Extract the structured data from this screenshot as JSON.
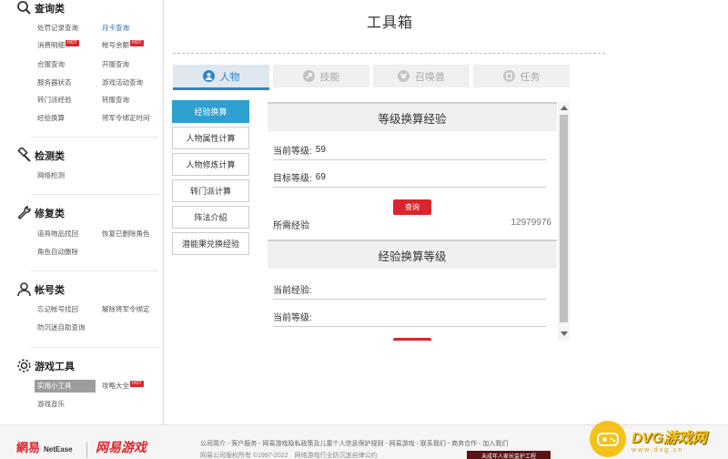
{
  "page": {
    "title": "工具箱"
  },
  "sidebar": {
    "query": {
      "title": "查询类",
      "items": [
        {
          "label": "处罚记录查询"
        },
        {
          "label": "月卡查询"
        },
        {
          "label": "消费明细"
        },
        {
          "label": "帐号余额"
        },
        {
          "label": "合服查询"
        },
        {
          "label": "开服查询"
        },
        {
          "label": "服务器状态"
        },
        {
          "label": "游戏活动查询"
        },
        {
          "label": "转门派经验"
        },
        {
          "label": "转服查询"
        },
        {
          "label": "经验换算"
        },
        {
          "label": "将军令绑定时间"
        }
      ],
      "hot_badge": "HOT"
    },
    "detect": {
      "title": "检测类",
      "items": [
        {
          "label": "网络检测"
        }
      ]
    },
    "repair": {
      "title": "修复类",
      "items": [
        {
          "label": "道具物品找回"
        },
        {
          "label": "恢复已删除角色"
        },
        {
          "label": "角色自动删除"
        }
      ]
    },
    "account": {
      "title": "帐号类",
      "items": [
        {
          "label": "忘记帐号找回"
        },
        {
          "label": "解除将军令绑定"
        },
        {
          "label": "防沉迷自助查询"
        }
      ]
    },
    "tools": {
      "title": "游戏工具",
      "items": [
        {
          "label": "实用小工具"
        },
        {
          "label": "攻略大全"
        },
        {
          "label": "游戏音乐"
        }
      ]
    }
  },
  "tabs": [
    {
      "label": "人物",
      "icon": "person-icon"
    },
    {
      "label": "技能",
      "icon": "skill-icon"
    },
    {
      "label": "召唤兽",
      "icon": "pet-icon"
    },
    {
      "label": "任务",
      "icon": "task-icon"
    }
  ],
  "leftnav": [
    {
      "label": "经验换算"
    },
    {
      "label": "人物属性计算"
    },
    {
      "label": "人物修炼计算"
    },
    {
      "label": "转门派计算"
    },
    {
      "label": "阵法介绍"
    },
    {
      "label": "潜能果兑换经验"
    }
  ],
  "calc1": {
    "title": "等级换算经验",
    "current_level_label": "当前等级:",
    "current_level_value": "59",
    "target_level_label": "目标等级:",
    "target_level_value": "69",
    "query_button": "查询",
    "result_label": "所需经验",
    "result_value": "12979976"
  },
  "calc2": {
    "title": "经验换算等级",
    "current_exp_label": "当前经验:",
    "current_level_label": "当前等级:",
    "query_button": "查询"
  },
  "footer": {
    "logo_cn": "網易",
    "logo_en": "NetEase",
    "logo2": "网易游戏",
    "links": "公司简介 - 客户服务 - 网易游戏隐私政策及儿童个人信息保护规则 - 网易游戏 - 联系我们 - 商务合作 - 加入我们",
    "copyright": "网易公司版权所有 ©1997-2022",
    "copyright_tail": "网络游戏行业防沉迷自律公约",
    "badge": "未成年人家长监护工程"
  },
  "watermark": {
    "title": "DVG游戏网",
    "url": "www.dvg.cn"
  },
  "colors": {
    "accent_blue": "#2d84c9",
    "accent_red": "#d9262c",
    "leftnav_active": "#2da0cf"
  }
}
